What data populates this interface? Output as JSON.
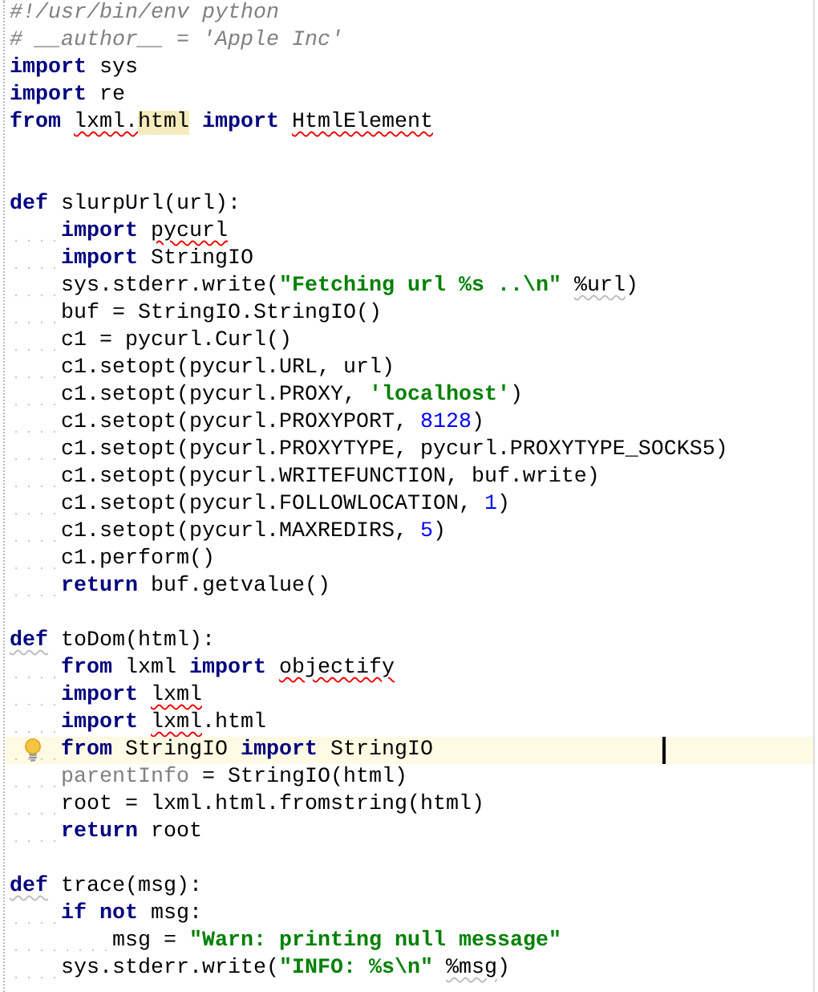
{
  "editor": {
    "lines": [
      {
        "kind": "code",
        "tokens": [
          {
            "t": "#!/usr/bin/env python",
            "kind": "comment"
          }
        ]
      },
      {
        "kind": "code",
        "tokens": [
          {
            "t": "# __author__ = 'Apple Inc'",
            "kind": "comment"
          }
        ]
      },
      {
        "kind": "code",
        "tokens": [
          {
            "t": "import",
            "kind": "keyword"
          },
          {
            "t": " sys",
            "kind": "plain"
          }
        ]
      },
      {
        "kind": "code",
        "tokens": [
          {
            "t": "import",
            "kind": "keyword"
          },
          {
            "t": " re",
            "kind": "plain"
          }
        ]
      },
      {
        "kind": "code",
        "tokens": [
          {
            "t": "from ",
            "kind": "keyword"
          },
          {
            "t": "lxml.",
            "kind": "plain",
            "typo": true
          },
          {
            "t": "html",
            "kind": "plain",
            "usage_highlight": true
          },
          {
            "t": " import ",
            "kind": "keyword"
          },
          {
            "t": "HtmlElement",
            "kind": "plain",
            "typo": true
          }
        ]
      },
      {
        "kind": "blank"
      },
      {
        "kind": "blank"
      },
      {
        "kind": "code",
        "tokens": [
          {
            "t": "def",
            "kind": "keyword"
          },
          {
            "t": " slurpUrl(url):",
            "kind": "plain"
          }
        ],
        "children": [
          {
            "kind": "code",
            "tokens": [
              {
                "t": "import ",
                "kind": "keyword"
              },
              {
                "t": "pycurl",
                "kind": "plain",
                "typo": true
              }
            ]
          },
          {
            "kind": "code",
            "tokens": [
              {
                "t": "import",
                "kind": "keyword"
              },
              {
                "t": " StringIO",
                "kind": "plain"
              }
            ]
          },
          {
            "kind": "code",
            "tokens": [
              {
                "t": "sys.stderr.write(",
                "kind": "plain"
              },
              {
                "t": "\"Fetching url %s ..\\n\" ",
                "kind": "string"
              },
              {
                "t": "%url",
                "kind": "plain",
                "weak_warning": true
              },
              {
                "t": ")",
                "kind": "plain"
              }
            ]
          },
          {
            "kind": "code",
            "tokens": [
              {
                "t": "buf = StringIO.StringIO()",
                "kind": "plain"
              }
            ]
          },
          {
            "kind": "code",
            "tokens": [
              {
                "t": "c1 = pycurl.Curl()",
                "kind": "plain"
              }
            ]
          },
          {
            "kind": "code",
            "tokens": [
              {
                "t": "c1.setopt(pycurl.URL, url)",
                "kind": "plain"
              }
            ]
          },
          {
            "kind": "code",
            "tokens": [
              {
                "t": "c1.setopt(pycurl.PROXY, ",
                "kind": "plain"
              },
              {
                "t": "'localhost'",
                "kind": "string"
              },
              {
                "t": ")",
                "kind": "plain"
              }
            ]
          },
          {
            "kind": "code",
            "tokens": [
              {
                "t": "c1.setopt(pycurl.PROXYPORT, ",
                "kind": "plain"
              },
              {
                "t": "8128",
                "kind": "number"
              },
              {
                "t": ")",
                "kind": "plain"
              }
            ]
          },
          {
            "kind": "code",
            "tokens": [
              {
                "t": "c1.setopt(pycurl.PROXYTYPE, pycurl.PROXYTYPE_SOCKS5)",
                "kind": "plain"
              }
            ]
          },
          {
            "kind": "code",
            "tokens": [
              {
                "t": "c1.setopt(pycurl.WRITEFUNCTION, buf.write)",
                "kind": "plain"
              }
            ]
          },
          {
            "kind": "code",
            "tokens": [
              {
                "t": "c1.setopt(pycurl.FOLLOWLOCATION, ",
                "kind": "plain"
              },
              {
                "t": "1",
                "kind": "number"
              },
              {
                "t": ")",
                "kind": "plain"
              }
            ]
          },
          {
            "kind": "code",
            "tokens": [
              {
                "t": "c1.setopt(pycurl.MAXREDIRS, ",
                "kind": "plain"
              },
              {
                "t": "5",
                "kind": "number"
              },
              {
                "t": ")",
                "kind": "plain"
              }
            ]
          },
          {
            "kind": "code",
            "tokens": [
              {
                "t": "c1.perform()",
                "kind": "plain"
              }
            ]
          },
          {
            "kind": "code",
            "tokens": [
              {
                "t": "return",
                "kind": "keyword"
              },
              {
                "t": " buf.getvalue()",
                "kind": "plain"
              }
            ]
          }
        ]
      },
      {
        "kind": "blank"
      },
      {
        "kind": "code",
        "tokens": [
          {
            "t": "def",
            "kind": "keyword",
            "weak_warning": true
          },
          {
            "t": " toDom(html):",
            "kind": "plain"
          }
        ],
        "children": [
          {
            "kind": "code",
            "tokens": [
              {
                "t": "from",
                "kind": "keyword"
              },
              {
                "t": " lxml ",
                "kind": "plain"
              },
              {
                "t": "import ",
                "kind": "keyword"
              },
              {
                "t": "objectify",
                "kind": "plain",
                "typo": true
              }
            ]
          },
          {
            "kind": "code",
            "tokens": [
              {
                "t": "import ",
                "kind": "keyword"
              },
              {
                "t": "lxml",
                "kind": "plain",
                "typo": true
              }
            ]
          },
          {
            "kind": "code",
            "tokens": [
              {
                "t": "import ",
                "kind": "keyword"
              },
              {
                "t": "lxml",
                "kind": "plain",
                "typo": true
              },
              {
                "t": ".html",
                "kind": "plain"
              }
            ]
          },
          {
            "kind": "code",
            "current": true,
            "intention_bulb": true,
            "caret": true,
            "tokens": [
              {
                "t": "from",
                "kind": "keyword"
              },
              {
                "t": " StringIO ",
                "kind": "plain"
              },
              {
                "t": "import",
                "kind": "keyword"
              },
              {
                "t": " StringIO",
                "kind": "plain"
              }
            ]
          },
          {
            "kind": "code",
            "tokens": [
              {
                "t": "parentInfo",
                "kind": "unused"
              },
              {
                "t": " = StringIO(html)",
                "kind": "plain"
              }
            ]
          },
          {
            "kind": "code",
            "tokens": [
              {
                "t": "root = lxml.html.fromstring(html)",
                "kind": "plain"
              }
            ]
          },
          {
            "kind": "code",
            "tokens": [
              {
                "t": "return",
                "kind": "keyword"
              },
              {
                "t": " root",
                "kind": "plain"
              }
            ]
          }
        ]
      },
      {
        "kind": "blank"
      },
      {
        "kind": "code",
        "tokens": [
          {
            "t": "def",
            "kind": "keyword",
            "weak_warning": true
          },
          {
            "t": " trace(msg):",
            "kind": "plain"
          }
        ],
        "children": [
          {
            "kind": "code",
            "tokens": [
              {
                "t": "if not",
                "kind": "keyword"
              },
              {
                "t": " msg:",
                "kind": "plain"
              }
            ],
            "children": [
              {
                "kind": "code",
                "tokens": [
                  {
                    "t": "msg = ",
                    "kind": "plain"
                  },
                  {
                    "t": "\"Warn: printing null message\"",
                    "kind": "string"
                  }
                ]
              }
            ]
          },
          {
            "kind": "code",
            "tokens": [
              {
                "t": "sys.stderr.write(",
                "kind": "plain"
              },
              {
                "t": "\"INFO: %s\\n\" ",
                "kind": "string"
              },
              {
                "t": "%msg",
                "kind": "plain",
                "weak_warning": true
              },
              {
                "t": ")",
                "kind": "plain"
              }
            ]
          }
        ]
      }
    ]
  }
}
